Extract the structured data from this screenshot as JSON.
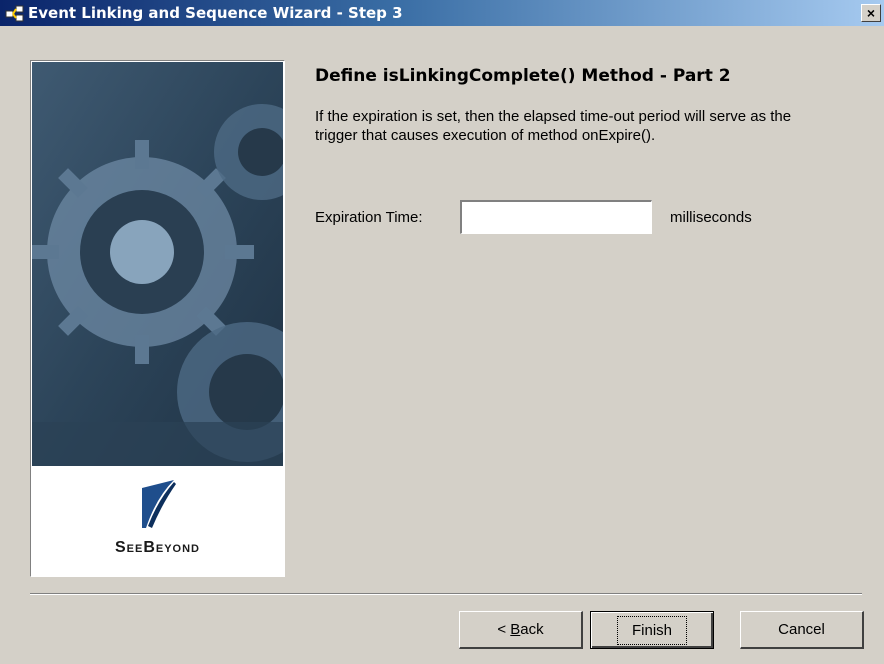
{
  "window": {
    "title": "Event Linking and Sequence Wizard - Step 3",
    "close_label": "×",
    "icon": "wizard-icon"
  },
  "side_panel": {
    "logo_text": "SeeBeyond",
    "logo_icon": "seebeyond-logo-icon",
    "image": "gears-image"
  },
  "content": {
    "heading": "Define isLinkingComplete() Method - Part 2",
    "description": "If the expiration is set, then the elapsed time-out period will serve as the trigger that causes execution of method onExpire().",
    "expiration_label": "Expiration Time:",
    "expiration_value": "",
    "unit_label": "milliseconds"
  },
  "buttons": {
    "back_prefix": "< ",
    "back_mnemonic": "B",
    "back_rest": "ack",
    "finish": "Finish",
    "cancel": "Cancel"
  },
  "colors": {
    "titlebar_start": "#0a246a",
    "titlebar_end": "#a6caf0",
    "dialog_bg": "#d4d0c8"
  }
}
